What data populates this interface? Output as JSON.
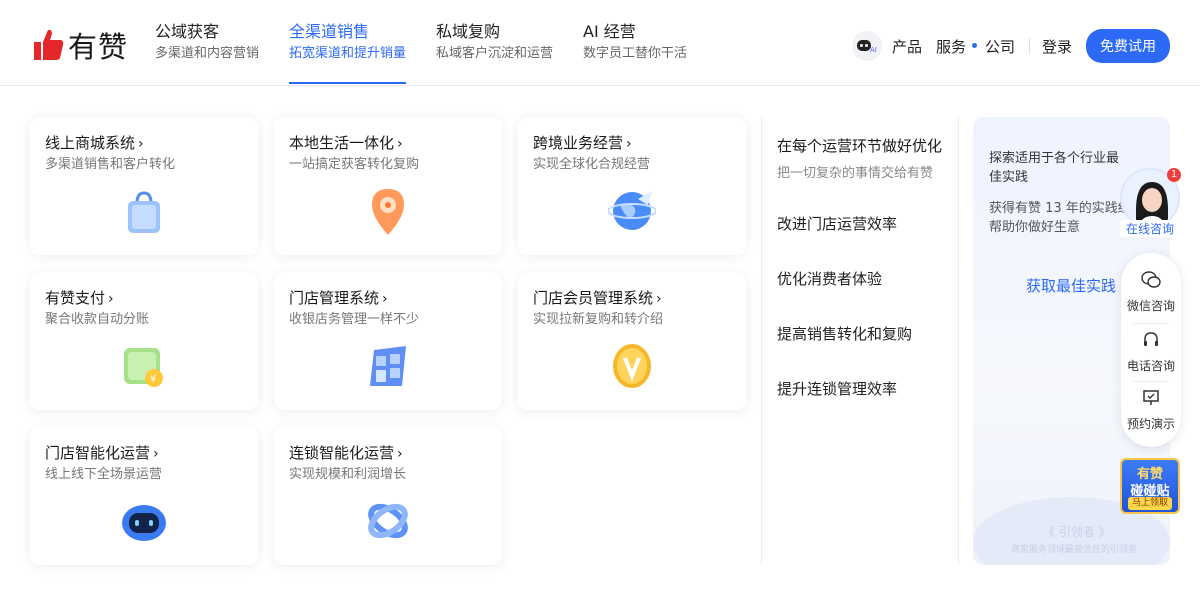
{
  "brand": {
    "name": "有赞",
    "accent": "#2c69f5"
  },
  "nav": [
    {
      "title": "公域获客",
      "sub": "多渠道和内容营销"
    },
    {
      "title": "全渠道销售",
      "sub": "拓宽渠道和提升销量"
    },
    {
      "title": "私域复购",
      "sub": "私域客户沉淀和运营"
    },
    {
      "title": "AI 经营",
      "sub": "数字员工替你干活"
    }
  ],
  "right_nav": {
    "product": "产品",
    "service": "服务",
    "company": "公司",
    "login": "登录",
    "trial": "免费试用"
  },
  "cards": [
    {
      "title": "线上商城系统",
      "desc": "多渠道销售和客户转化",
      "icon": "shopping-bag-icon"
    },
    {
      "title": "本地生活一体化",
      "desc": "一站搞定获客转化复购",
      "icon": "location-pin-icon"
    },
    {
      "title": "跨境业务经营",
      "desc": "实现全球化合规经营",
      "icon": "globe-plane-icon"
    },
    {
      "title": "有赞支付",
      "desc": "聚合收款自动分账",
      "icon": "wallet-icon"
    },
    {
      "title": "门店管理系统",
      "desc": "收银店务管理一样不少",
      "icon": "store-icon"
    },
    {
      "title": "门店会员管理系统",
      "desc": "实现拉新复购和转介绍",
      "icon": "vip-coin-icon"
    },
    {
      "title": "门店智能化运营",
      "desc": "线上线下全场景运营",
      "icon": "robot-icon"
    },
    {
      "title": "连锁智能化运营",
      "desc": "实现规模和利润增长",
      "icon": "rings-icon"
    }
  ],
  "mid": {
    "head": "在每个运营环节做好优化",
    "sub": "把一切复杂的事情交给有赞",
    "items": [
      "改进门店运营效率",
      "优化消费者体验",
      "提高销售转化和复购",
      "提升连锁管理效率"
    ]
  },
  "panel": {
    "line1": "探索适用于各个行业最佳实践",
    "line2a": "获得有赞 13 年的实践经",
    "line2b": "帮助你做好生意",
    "link": "获取最佳实践",
    "watermark1": "《 引领者 》",
    "watermark2": "商家服务领域最被信任的引领者"
  },
  "consult": {
    "badge": "1",
    "online": "在线咨询",
    "wechat": "微信咨询",
    "phone": "电话咨询",
    "demo": "预约演示",
    "promo_top": "有赞",
    "promo_mid": "碰碰贴",
    "promo_btn": "马上领取"
  }
}
